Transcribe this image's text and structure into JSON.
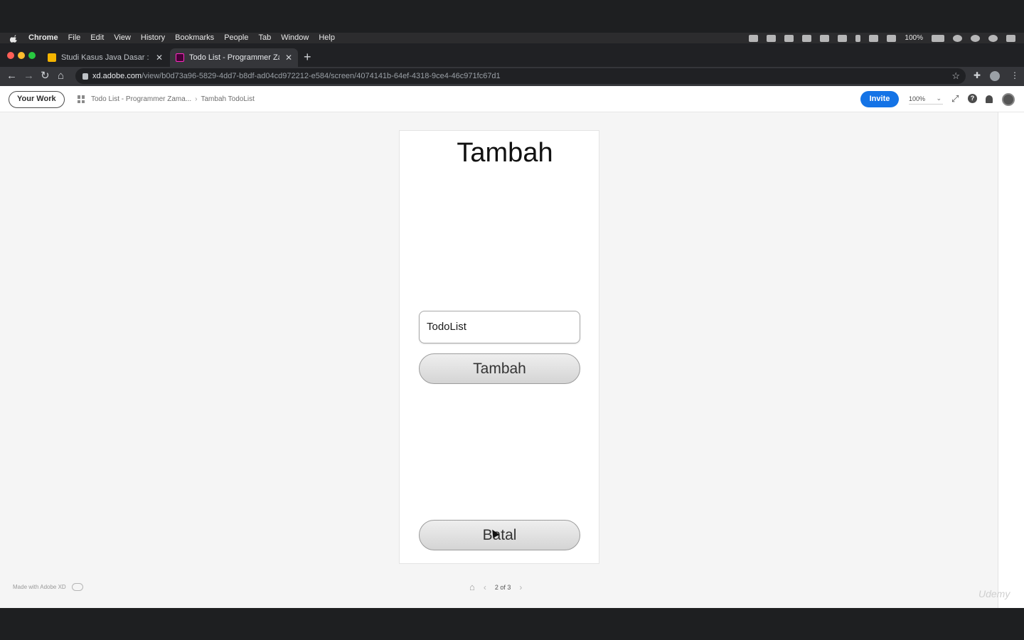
{
  "menubar": {
    "items": [
      "Chrome",
      "File",
      "Edit",
      "View",
      "History",
      "Bookmarks",
      "People",
      "Tab",
      "Window",
      "Help"
    ],
    "battery_text": "100%"
  },
  "tabs": [
    {
      "title": "Studi Kasus Java Dasar : Aplik",
      "favicon_color": "#f4b400",
      "active": false
    },
    {
      "title": "Todo List - Programmer Zaman",
      "favicon_color": "#ff2bc2",
      "active": true
    }
  ],
  "address": {
    "host": "xd.adobe.com",
    "path": "/view/b0d73a96-5829-4dd7-b8df-ad04cd972212-e584/screen/4074141b-64ef-4318-9ce4-46c971fc67d1"
  },
  "header": {
    "your_work": "Your Work",
    "breadcrumb_project": "Todo List - Programmer Zama...",
    "breadcrumb_screen": "Tambah TodoList",
    "invite": "Invite",
    "zoom": "100%"
  },
  "artboard": {
    "title": "Tambah",
    "input_value": "TodoList",
    "button_add": "Tambah",
    "button_cancel": "Batal"
  },
  "footer": {
    "made_with": "Made with Adobe XD",
    "page_indicator": "2 of 3",
    "watermark": "Udemy"
  },
  "colors": {
    "accent": "#1473e6",
    "traffic_red": "#ff5f57",
    "traffic_yellow": "#febc2e",
    "traffic_green": "#28c840"
  }
}
